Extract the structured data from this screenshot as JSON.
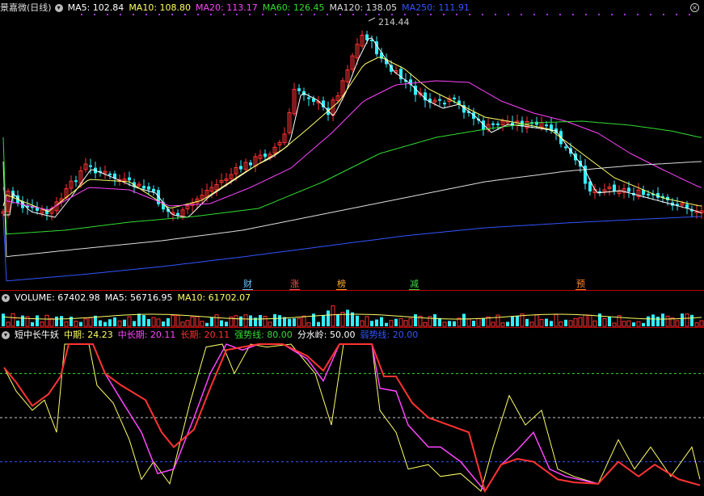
{
  "main_panel": {
    "stock_name": "景嘉微(日线)",
    "ma": [
      {
        "label": "MA5: 102.84",
        "color": "#ffffff"
      },
      {
        "label": "MA10: 108.80",
        "color": "#ffff66"
      },
      {
        "label": "MA20: 113.17",
        "color": "#ff44ff"
      },
      {
        "label": "MA60: 126.45",
        "color": "#33dd33"
      },
      {
        "label": "MA120: 138.05",
        "color": "#dddddd"
      },
      {
        "label": "MA250: 111.91",
        "color": "#3355ff"
      }
    ],
    "high_label": "214.44",
    "events": [
      {
        "text": "财",
        "color": "#66ccff"
      },
      {
        "text": "涨",
        "color": "#ff5555"
      },
      {
        "text": "榜",
        "color": "#ffaa33"
      },
      {
        "text": "减",
        "color": "#44dd44"
      },
      {
        "text": "预",
        "color": "#ff8833"
      }
    ]
  },
  "volume_panel": {
    "volume": "VOLUME: 67402.98",
    "ma5": "MA5: 56716.95",
    "ma10": "MA10: 61702.07"
  },
  "indicator_panel": {
    "name": "短中长牛妖",
    "short": "中期: 24.23",
    "mid": "中长期: 20.11",
    "long": "长期: 20.11",
    "strong": "强势线: 80.00",
    "water": "分水岭: 50.00",
    "weak": "弱势线: 20.00"
  },
  "colors": {
    "up": "#ff3333",
    "down": "#33eeff",
    "ma5": "#ffffff",
    "ma10": "#ffff66",
    "ma20": "#ff44ff",
    "ma60": "#33dd33",
    "ma120": "#dddddd",
    "ma250": "#3355ff"
  }
}
